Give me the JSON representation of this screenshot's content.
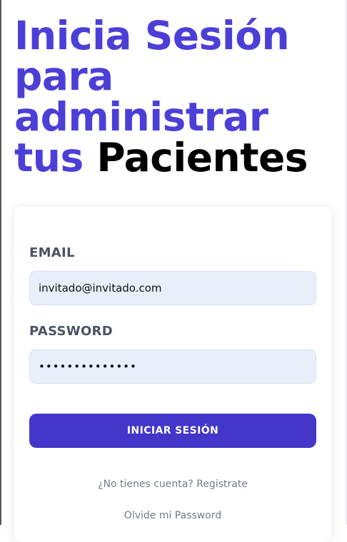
{
  "heading": {
    "line1": "Inicia Sesión",
    "line2": "para",
    "line3": "administrar",
    "line4_accent": "tus",
    "line4_dark": "Pacientes"
  },
  "form": {
    "email_label": "EMAIL",
    "email_value": "invitado@invitado.com",
    "password_label": "PASSWORD",
    "password_value": "••••••••••••••",
    "submit_label": "INICIAR SESIÓN"
  },
  "links": {
    "register": "¿No tienes cuenta? Registrate",
    "forgot": "Olvide mi Password"
  },
  "colors": {
    "accent": "#4c3fd8",
    "button": "#4436c9",
    "input_bg": "#e8effb",
    "label": "#4a5264",
    "link": "#747b88"
  }
}
